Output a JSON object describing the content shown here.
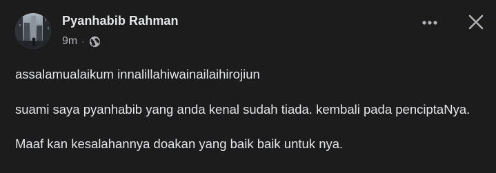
{
  "post": {
    "author": "Pyanhabib Rahman",
    "time": "9m",
    "separator": "·",
    "audience_icon": "globe-icon",
    "more_icon": "more-options-icon",
    "close_icon": "close-icon",
    "paragraphs": [
      "assalamualaikum innalillahiwainailaihirojiun",
      "suami saya pyanhabib yang anda kenal sudah tiada. kembali pada penciptaNya.",
      "Maaf kan kesalahannya doakan yang baik baik untuk nya."
    ]
  },
  "colors": {
    "background": "#1c1c1d",
    "primary_text": "#e4e6eb",
    "secondary_text": "#b0b3b8"
  }
}
